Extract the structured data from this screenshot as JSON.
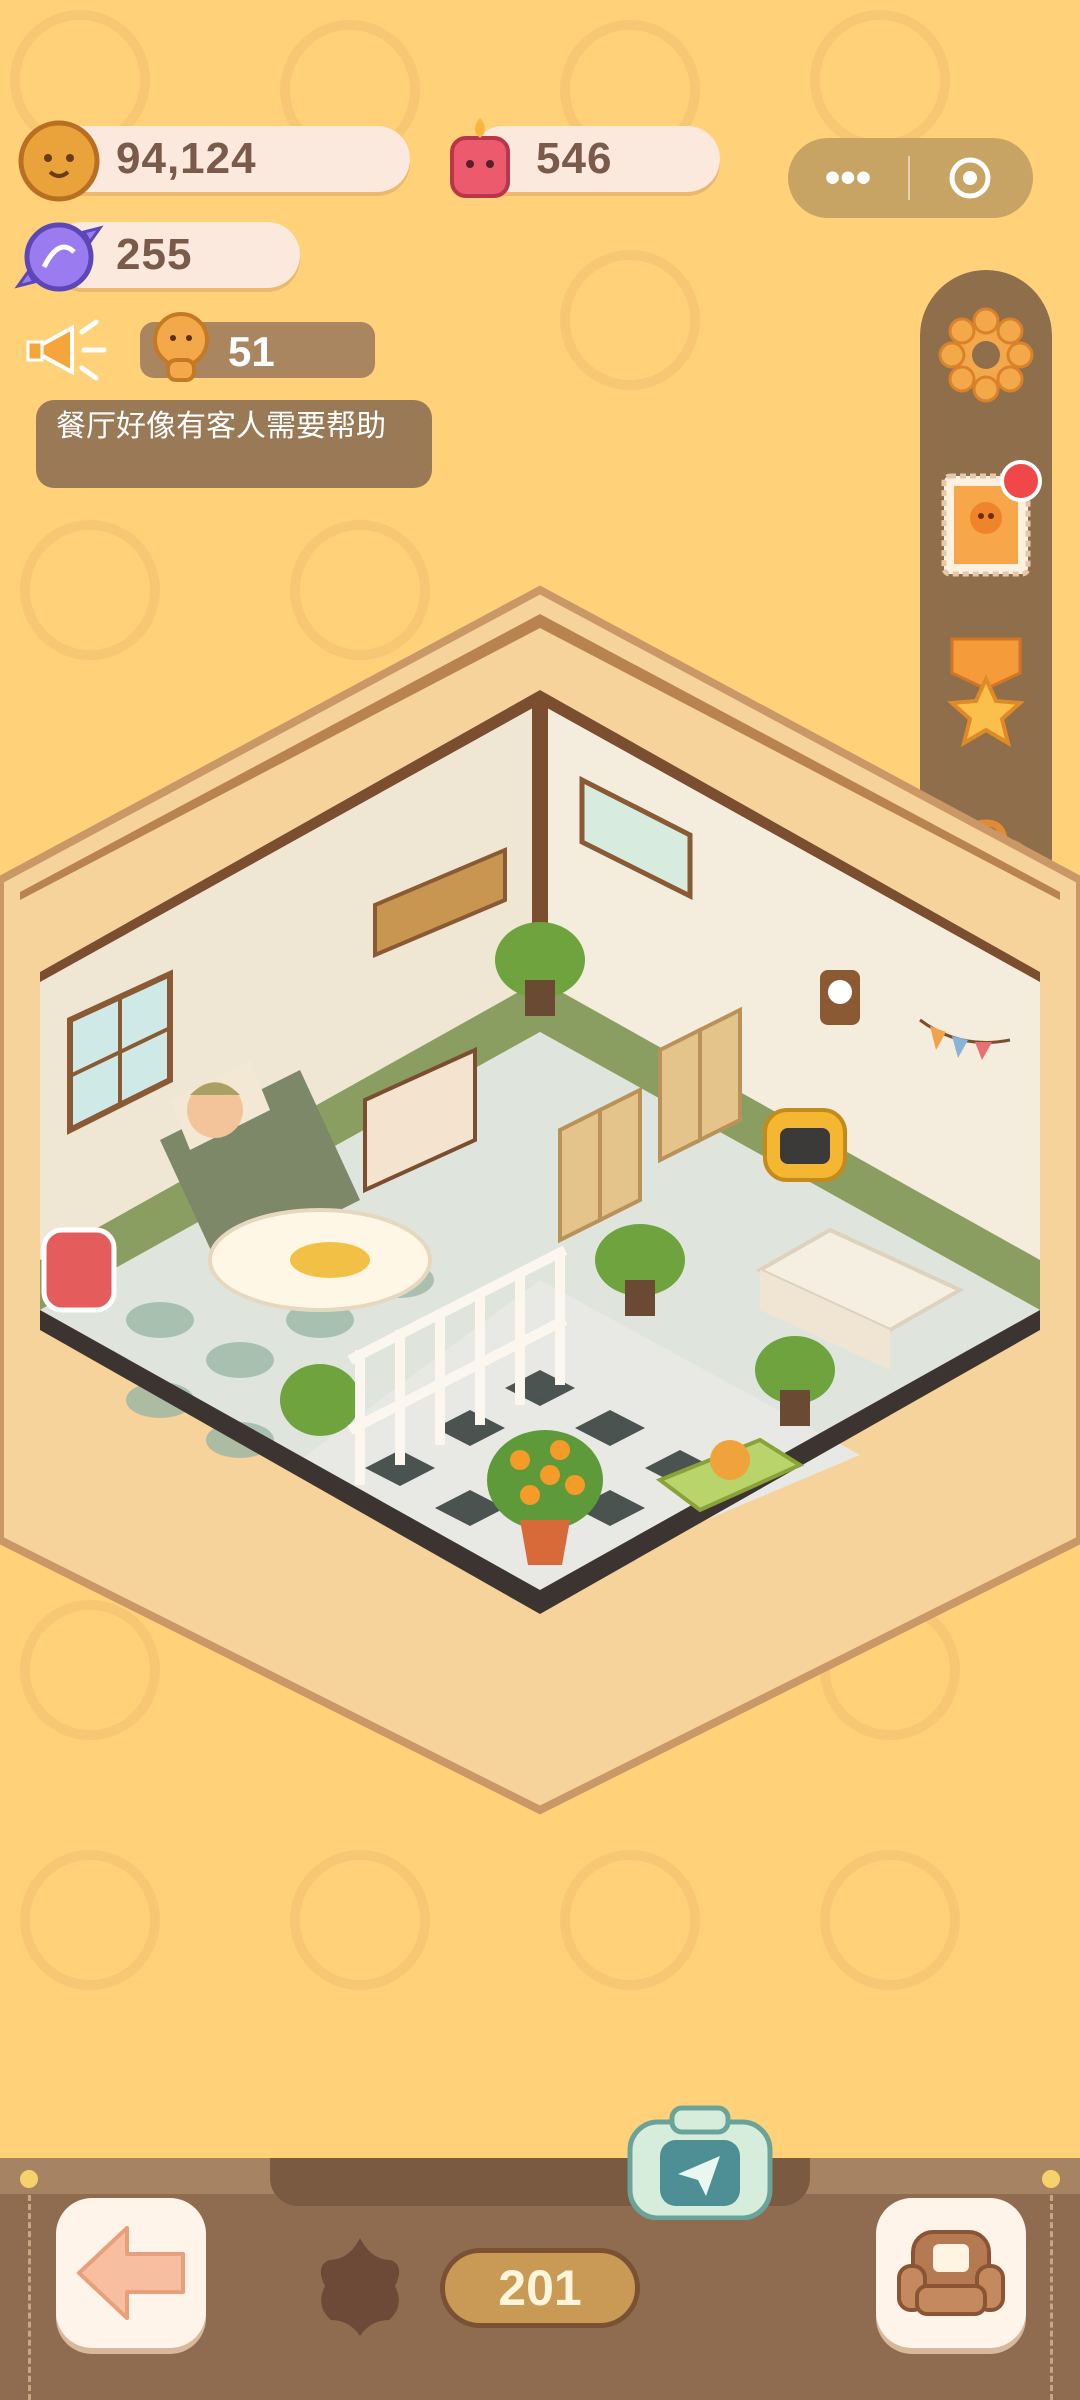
{
  "resources": {
    "cookies": "94,124",
    "gems": "546",
    "candy": "255"
  },
  "notice": {
    "count": "51",
    "message": "餐厅好像有客人需要帮助"
  },
  "capsule": {
    "menu_glyph": "•••"
  },
  "side_buttons": [
    {
      "name": "settings",
      "icon": "gear-icon"
    },
    {
      "name": "stamp",
      "icon": "stamp-card-icon",
      "badge": true
    },
    {
      "name": "achievement",
      "icon": "medal-star-icon"
    },
    {
      "name": "bag",
      "icon": "backpack-icon"
    }
  ],
  "bottom": {
    "level_count": "201",
    "back_icon": "arrow-left-icon",
    "furniture_icon": "armchair-icon",
    "camera_icon": "camera-send-icon"
  },
  "colors": {
    "background": "#ffd27a",
    "panel": "#8f6e4c",
    "pill": "#fbe9dd",
    "text_dark": "#7a5a48"
  }
}
